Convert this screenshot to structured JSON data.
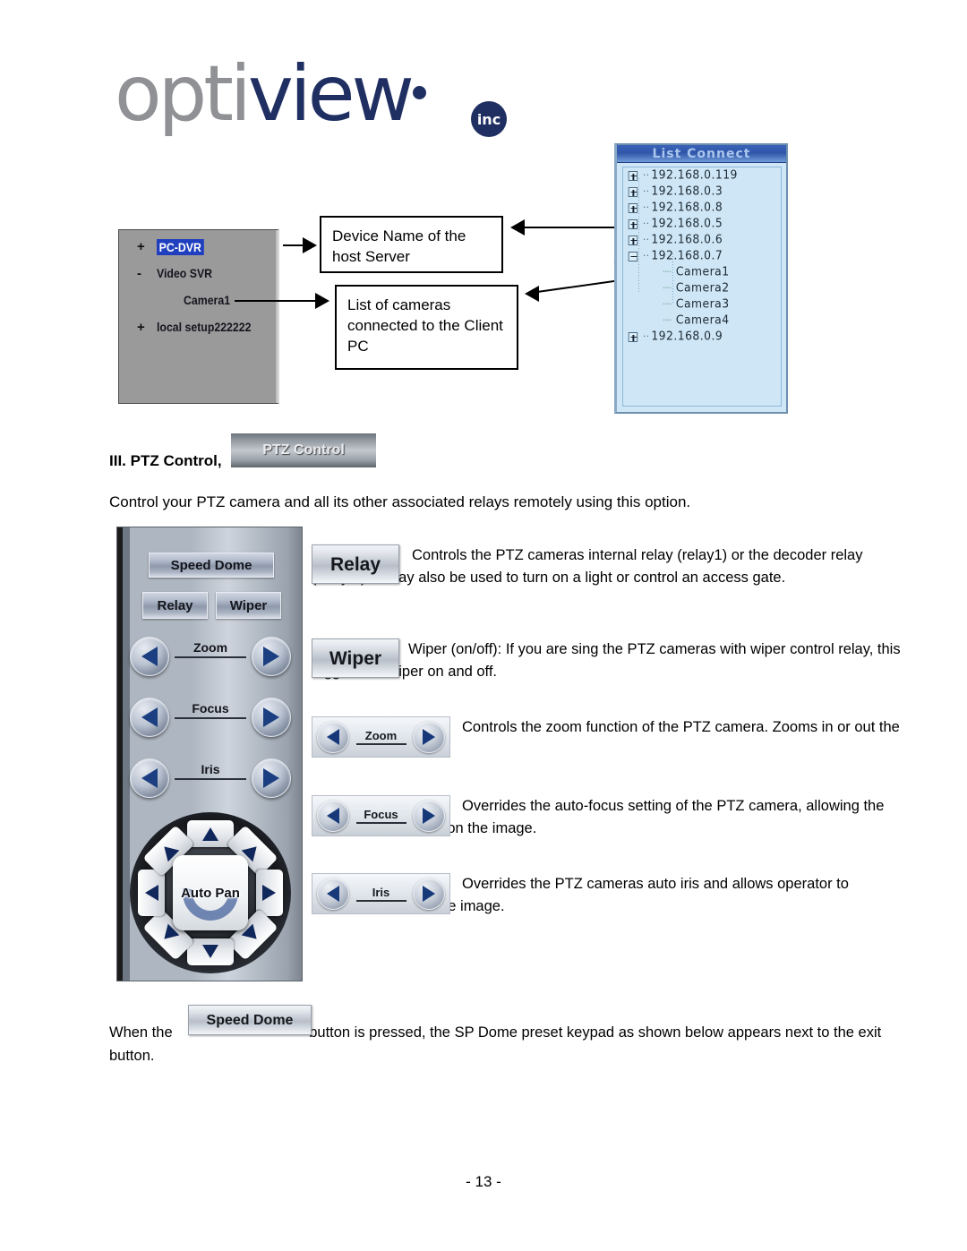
{
  "logo": {
    "part1": "opti",
    "part2": "view",
    "suffix": "inc",
    "brand_gray": "#8f9194",
    "brand_blue": "#1f2f62"
  },
  "device_tree": {
    "nodes": [
      {
        "sign": "+",
        "label": "PC-DVR",
        "selected": true
      },
      {
        "sign": "-",
        "label": "Video SVR",
        "selected": false
      },
      {
        "sign": "",
        "label": "Camera1",
        "selected": false
      },
      {
        "sign": "+",
        "label": "local setup222222",
        "selected": false
      }
    ]
  },
  "callouts": {
    "device_name": "Device Name of the host Server",
    "camera_list": "List of cameras connected to the Client PC"
  },
  "list_connect": {
    "title": "List Connect",
    "rows": [
      {
        "expander": "plus",
        "label": "192.168.0.119",
        "child": false
      },
      {
        "expander": "plus",
        "label": "192.168.0.3",
        "child": false
      },
      {
        "expander": "plus",
        "label": "192.168.0.8",
        "child": false
      },
      {
        "expander": "plus",
        "label": "192.168.0.5",
        "child": false
      },
      {
        "expander": "plus",
        "label": "192.168.0.6",
        "child": false
      },
      {
        "expander": "minus",
        "label": "192.168.0.7",
        "child": false
      },
      {
        "expander": "none",
        "label": "Camera1",
        "child": true
      },
      {
        "expander": "none",
        "label": "Camera2",
        "child": true
      },
      {
        "expander": "none",
        "label": "Camera3",
        "child": true
      },
      {
        "expander": "none",
        "label": "Camera4",
        "child": true
      },
      {
        "expander": "plus",
        "label": "192.168.0.9",
        "child": false
      }
    ]
  },
  "section": {
    "heading": "III. PTZ Control,",
    "ptz_control_button": "PTZ Control",
    "intro": "Control your PTZ camera and all its other associated relays remotely using this option."
  },
  "ptz_panel": {
    "speed_dome": "Speed Dome",
    "relay": "Relay",
    "wiper": "Wiper",
    "zoom": "Zoom",
    "focus": "Focus",
    "iris": "Iris",
    "auto_pan": "Auto Pan"
  },
  "descriptions": [
    {
      "control": "Relay",
      "text": "Controls the PTZ cameras internal relay (relay1) or the decoder relay (relay 1). It may also be used to turn on a light or control an access gate."
    },
    {
      "control": "Wiper",
      "text": "Wiper (on/off): If you are sing the PTZ cameras with wiper control relay, this toggles the wiper on and off."
    },
    {
      "control": "Zoom",
      "text": "Controls the zoom function of the PTZ camera. Zooms in or out the image."
    },
    {
      "control": "Focus",
      "text": "Overrides the auto-focus setting of the PTZ camera, allowing the user to further focus on the image."
    },
    {
      "control": "Iris",
      "text": "Overrides the PTZ cameras auto iris and allows operator to brighten or darken the image."
    }
  ],
  "bottom": {
    "before": "When the",
    "button": "Speed Dome",
    "after": "button is pressed, the SP Dome preset keypad as shown below appears next to the exit button."
  },
  "footer": {
    "page_number": "- 13 -"
  }
}
